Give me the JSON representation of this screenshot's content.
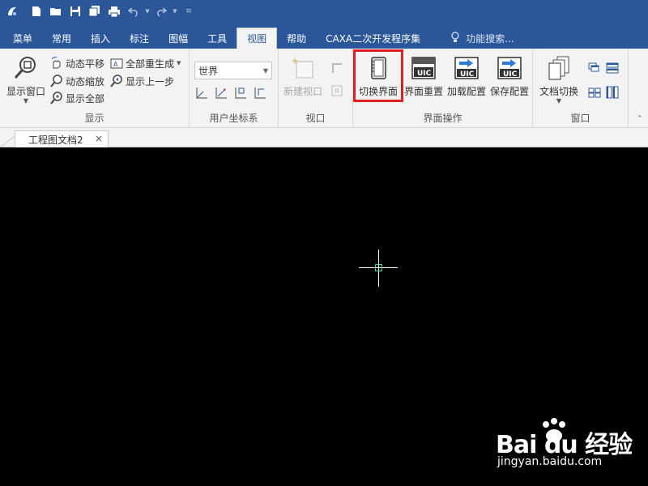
{
  "quick_access": {
    "icons": [
      "app-logo-icon",
      "new-file-icon",
      "open-folder-icon",
      "save-icon",
      "save-all-icon",
      "print-icon",
      "undo-icon",
      "redo-icon",
      "customize-icon"
    ]
  },
  "menu_tabs": [
    {
      "label": "菜单",
      "active": false
    },
    {
      "label": "常用",
      "active": false
    },
    {
      "label": "插入",
      "active": false
    },
    {
      "label": "标注",
      "active": false
    },
    {
      "label": "图幅",
      "active": false
    },
    {
      "label": "工具",
      "active": false
    },
    {
      "label": "视图",
      "active": true
    },
    {
      "label": "帮助",
      "active": false
    },
    {
      "label": "CAXA二次开发程序集",
      "active": false
    }
  ],
  "search": {
    "placeholder": "功能搜索..."
  },
  "ribbon": {
    "display_group": {
      "label": "显示",
      "show_window": "显示窗口",
      "dynamic_pan": "动态平移",
      "dynamic_zoom": "动态缩放",
      "show_all": "显示全部",
      "regenerate_all": "全部重生成",
      "show_previous": "显示上一步"
    },
    "ucs_group": {
      "label": "用户坐标系",
      "combo_value": "世界"
    },
    "viewport_group": {
      "label": "视口",
      "new_viewport": "新建视口"
    },
    "ui_ops_group": {
      "label": "界面操作",
      "switch_ui": "切换界面",
      "reset_ui": "界面重置",
      "load_config": "加载配置",
      "save_config": "保存配置"
    },
    "window_group": {
      "label": "窗口",
      "doc_switch": "文档切换"
    }
  },
  "document_tab": {
    "title": "工程图文档2",
    "close": "×"
  },
  "watermark": {
    "logo": "Bai du 经验",
    "url": "jingyan.baidu.com"
  },
  "colors": {
    "accent": "#2b579a",
    "highlight": "#e02020",
    "cursor_box": "#3ddc84"
  }
}
